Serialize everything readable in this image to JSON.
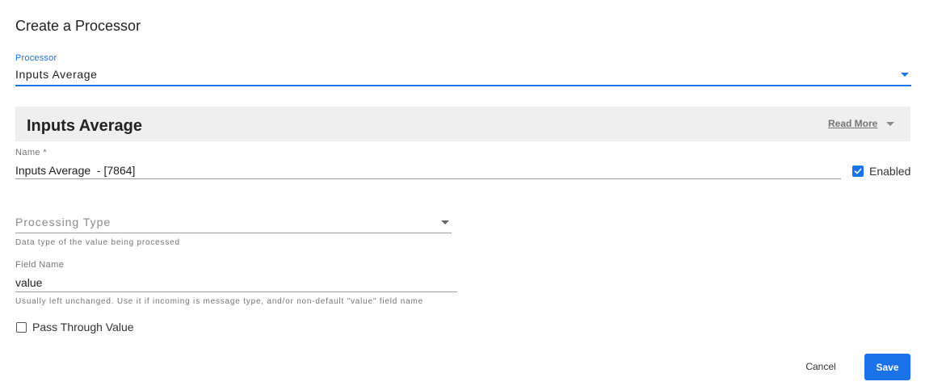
{
  "dialog": {
    "title": "Create a Processor"
  },
  "processor_select": {
    "label": "Processor",
    "value": "Inputs Average"
  },
  "info_header": {
    "title": "Inputs Average",
    "read_more": "Read More"
  },
  "name_field": {
    "label": "Name *",
    "value": "Inputs Average  - [7864]"
  },
  "enabled": {
    "label": "Enabled",
    "checked": true
  },
  "processing_type": {
    "placeholder": "Processing Type",
    "hint": "Data type of the value being processed"
  },
  "field_name": {
    "label": "Field Name",
    "value": "value",
    "hint": "Usually left unchanged. Use it if incoming is message type, and/or non-default \"value\" field name"
  },
  "pass_through": {
    "label": "Pass Through Value",
    "checked": false
  },
  "actions": {
    "cancel": "Cancel",
    "save": "Save"
  },
  "colors": {
    "accent": "#1a73e8",
    "header_bg": "#efefef"
  }
}
